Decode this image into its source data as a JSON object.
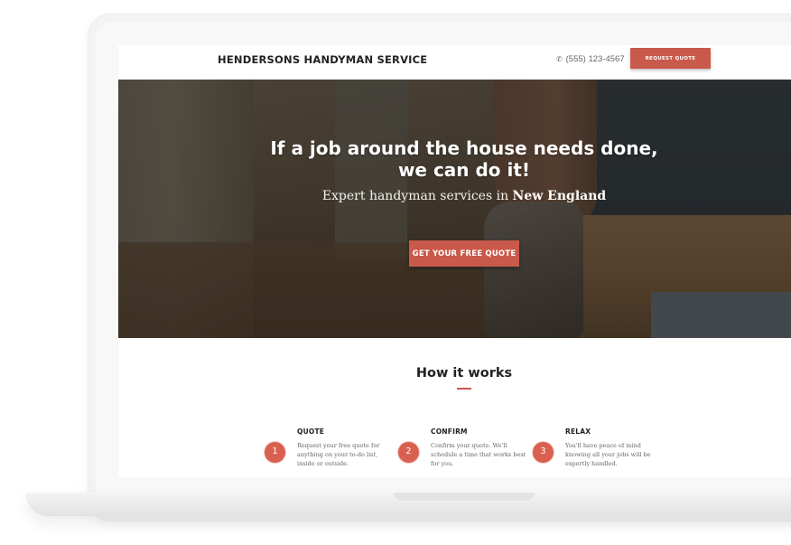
{
  "navbar": {
    "brand": "HENDERSONS HANDYMAN SERVICE",
    "phone": "(555) 123-4567",
    "phone_icon": "phone-icon",
    "cta_label": "REQUEST QUOTE"
  },
  "hero": {
    "title_line1": "If a job around the house needs done,",
    "title_line2": "we can do it!",
    "subtitle_prefix": "Expert handyman services in ",
    "subtitle_emphasis": "New England",
    "cta_label": "GET YOUR FREE QUOTE"
  },
  "how_it_works": {
    "title": "How it works",
    "steps": [
      {
        "number": "1",
        "title": "QUOTE",
        "lines": [
          "Request your free quote for",
          "anything on your to-do list,",
          "inside or outside."
        ]
      },
      {
        "number": "2",
        "title": "CONFIRM",
        "lines": [
          "Confirm your quote. We'll",
          "schedule a time that works best",
          "for you."
        ]
      },
      {
        "number": "3",
        "title": "RELAX",
        "lines": [
          "You'll have peace of mind",
          "knowing all your jobs will be",
          "expertly handled."
        ]
      }
    ]
  },
  "colors": {
    "accent": "#c9594a",
    "step_circle": "#d9604f",
    "heading": "#222222",
    "body_text": "#666666"
  }
}
